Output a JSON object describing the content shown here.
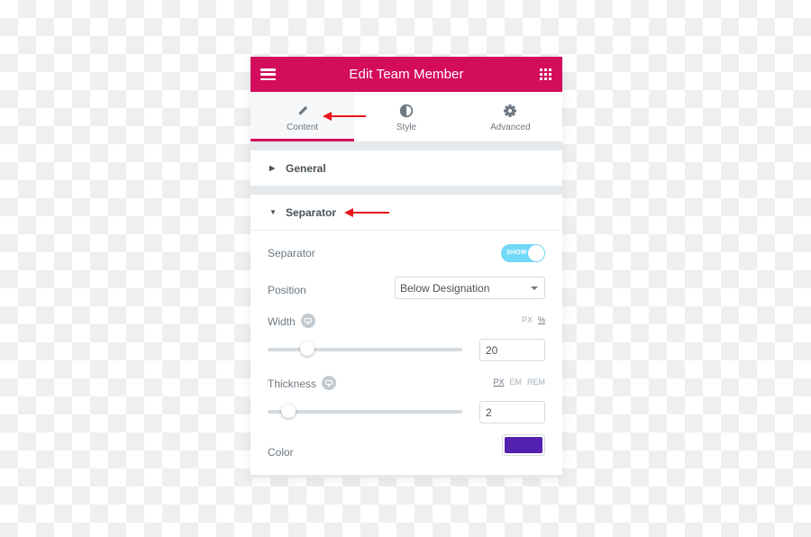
{
  "header": {
    "title": "Edit Team Member",
    "menu_icon": "hamburger-icon",
    "apps_icon": "grid-icon"
  },
  "tabs": [
    {
      "label": "Content",
      "icon": "pencil-icon",
      "active": true
    },
    {
      "label": "Style",
      "icon": "half-circle-icon",
      "active": false
    },
    {
      "label": "Advanced",
      "icon": "gear-icon",
      "active": false
    }
  ],
  "sections": {
    "general": {
      "title": "General",
      "expanded": false
    },
    "separator": {
      "title": "Separator",
      "expanded": true
    }
  },
  "controls": {
    "separator": {
      "label": "Separator",
      "toggle_text": "SHOW",
      "on": true
    },
    "position": {
      "label": "Position",
      "value": "Below Designation"
    },
    "width": {
      "label": "Width",
      "units": [
        "PX",
        "%"
      ],
      "active_unit": "%",
      "value": "20",
      "slider_fraction": 0.2
    },
    "thickness": {
      "label": "Thickness",
      "units": [
        "PX",
        "EM",
        "REM"
      ],
      "active_unit": "PX",
      "value": "2",
      "slider_fraction": 0.1
    },
    "color": {
      "label": "Color",
      "value": "#5420b0"
    }
  },
  "colors": {
    "brand": "#d30c5c",
    "toggle": "#71d7f7",
    "annotation": "#e8151b"
  }
}
